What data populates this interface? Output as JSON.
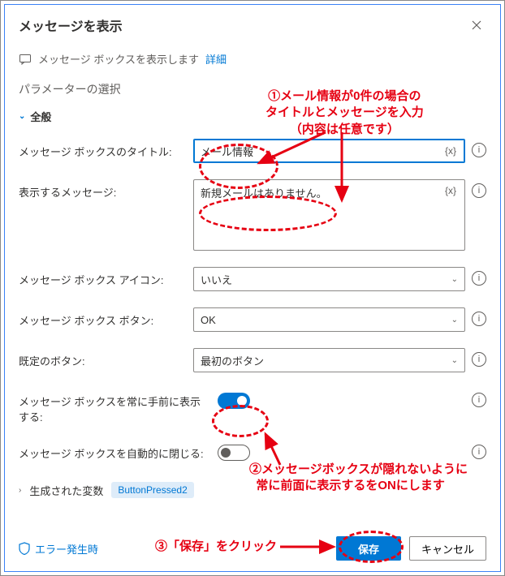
{
  "header": {
    "title": "メッセージを表示"
  },
  "infobar": {
    "text": "メッセージ ボックスを表示します",
    "details_link": "詳細"
  },
  "section": {
    "title": "パラメーターの選択",
    "group": "全般"
  },
  "fields": {
    "title_label": "メッセージ ボックスのタイトル:",
    "title_value": "メール情報",
    "message_label": "表示するメッセージ:",
    "message_value": "新規メールはありません。",
    "icon_label": "メッセージ ボックス アイコン:",
    "icon_value": "いいえ",
    "buttons_label": "メッセージ ボックス ボタン:",
    "buttons_value": "OK",
    "default_label": "既定のボタン:",
    "default_value": "最初のボタン",
    "always_front_label": "メッセージ ボックスを常に手前に表示する:",
    "auto_close_label": "メッセージ ボックスを自動的に閉じる:",
    "fx": "{x}"
  },
  "generated_vars": {
    "label": "生成された変数",
    "var": "ButtonPressed2"
  },
  "footer": {
    "error_link": "エラー発生時",
    "save": "保存",
    "cancel": "キャンセル"
  },
  "annotations": {
    "a1": "①メール情報が0件の場合の\nタイトルとメッセージを入力\n（内容は任意です）",
    "a2": "②メッセージボックスが隠れないように\n  常に前面に表示するをONにします",
    "a3": "③「保存」をクリック"
  }
}
